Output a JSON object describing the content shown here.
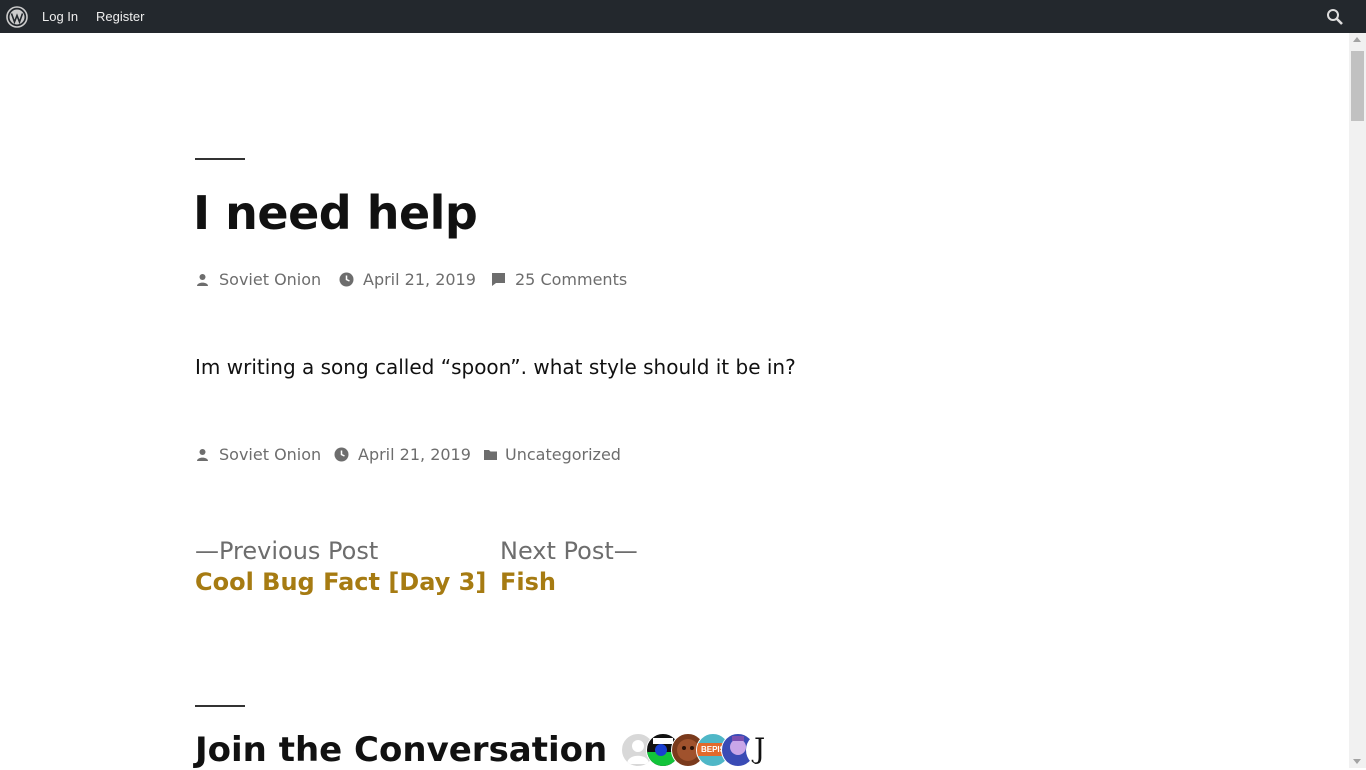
{
  "adminbar": {
    "login_label": "Log In",
    "register_label": "Register",
    "background": "#23282d"
  },
  "post": {
    "title": "I need help",
    "author": "Soviet Onion",
    "date": "April 21, 2019",
    "comments": "25 Comments",
    "content": "Im writing a song called “spoon”. what style should it be in?",
    "category": "Uncategorized"
  },
  "navigation": {
    "previous_label": "—Previous Post",
    "previous_title": "Cool Bug Fact [Day 3]",
    "next_label": "Next Post—",
    "next_title": "Fish"
  },
  "comments_section": {
    "title": "Join the Conversation",
    "avatar_badge_text": "BEPIS",
    "avatar_letter": "J"
  },
  "colors": {
    "accent": "#a67b12",
    "meta": "#6d6d6d",
    "text": "#111111"
  },
  "icons": [
    "wordpress-logo-icon",
    "search-icon",
    "person-icon",
    "clock-icon",
    "comment-icon",
    "folder-icon"
  ]
}
